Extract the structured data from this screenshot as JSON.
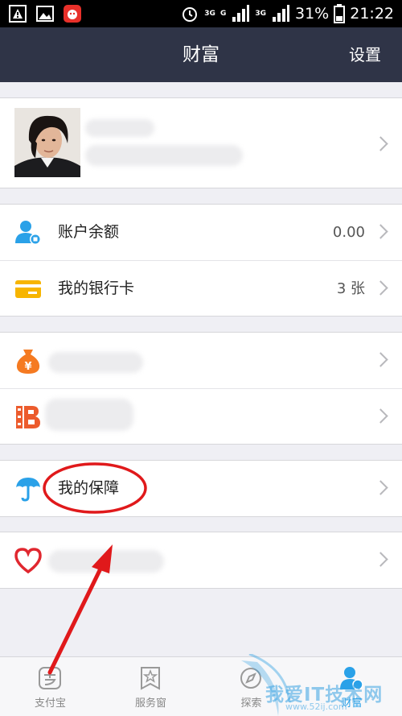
{
  "status_bar": {
    "battery_percent": "31%",
    "time": "21:22",
    "net1": "3G",
    "net2": "G",
    "net3": "3G"
  },
  "header": {
    "title": "财富",
    "settings_label": "设置"
  },
  "profile": {
    "avatar_icon": "avatar-photo"
  },
  "section_account": [
    {
      "icon": "user-balance-icon",
      "label": "账户余额",
      "value": "0.00"
    },
    {
      "icon": "bank-card-icon",
      "label": "我的银行卡",
      "value": "3 张"
    }
  ],
  "section_funds": [
    {
      "icon": "money-bag-icon",
      "label": ""
    },
    {
      "icon": "b-logo-icon",
      "label": ""
    }
  ],
  "section_insurance": [
    {
      "icon": "umbrella-icon",
      "label": "我的保障"
    }
  ],
  "section_charity": [
    {
      "icon": "heart-icon",
      "label": ""
    }
  ],
  "tabbar": {
    "tabs": [
      {
        "label": "支付宝",
        "icon": "alipay-icon"
      },
      {
        "label": "服务窗",
        "icon": "star-window-icon"
      },
      {
        "label": "探索",
        "icon": "explore-icon"
      },
      {
        "label": "财富",
        "icon": "wealth-icon"
      }
    ]
  },
  "watermark": {
    "text": "我爱IT技术网",
    "url": "www.52ij.com"
  },
  "colors": {
    "navbar": "#2f3447",
    "annotation_red": "#e0191b",
    "icon_blue": "#2aa1e8",
    "icon_orange": "#f57a21",
    "icon_yellow": "#f7b500"
  }
}
